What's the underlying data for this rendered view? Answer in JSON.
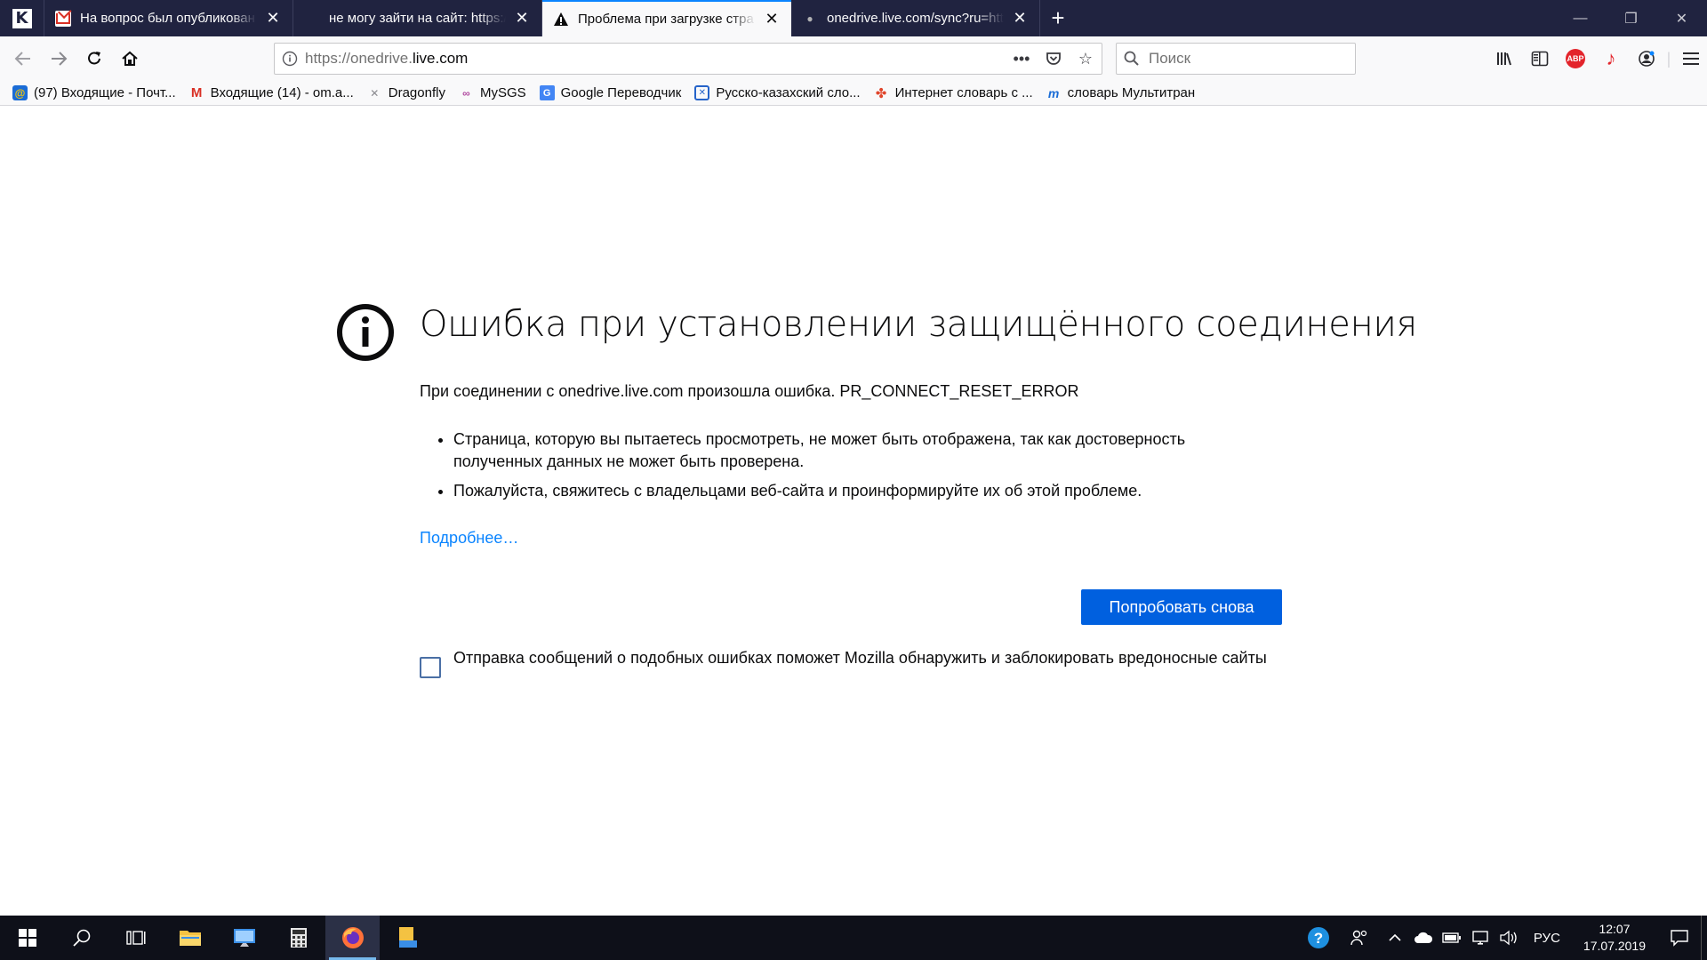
{
  "tabs": [
    {
      "title": "На вопрос был опубликован",
      "favicon": "gmail-icon",
      "active": false
    },
    {
      "title": "не могу зайти на сайт: https://",
      "favicon": "microsoft-icon",
      "active": false
    },
    {
      "title": "Проблема при загрузке стра",
      "favicon": "warning-icon",
      "active": true
    },
    {
      "title": "onedrive.live.com/sync?ru=http",
      "favicon": "loading-dot-icon",
      "active": false
    }
  ],
  "nav": {
    "url_prefix": "https://onedrive.",
    "url_host": "live.com",
    "search_placeholder": "Поиск"
  },
  "bookmarks": [
    {
      "label": "(97) Входящие - Почт...",
      "icon": "mail-at-icon"
    },
    {
      "label": "Входящие (14) - om.a...",
      "icon": "gmail-icon"
    },
    {
      "label": "Dragonfly",
      "icon": "dragonfly-icon"
    },
    {
      "label": "MySGS",
      "icon": "mysgs-icon"
    },
    {
      "label": "Google Переводчик",
      "icon": "google-translate-icon"
    },
    {
      "label": "Русско-казахский сло...",
      "icon": "dictionary-icon"
    },
    {
      "label": "Интернет словарь с ...",
      "icon": "pinwheel-icon"
    },
    {
      "label": "словарь Мультитран",
      "icon": "multitran-icon"
    }
  ],
  "error": {
    "title": "Ошибка при установлении защищённого соединения",
    "description": "При соединении с onedrive.live.com произошла ошибка. PR_CONNECT_RESET_ERROR",
    "bullets": [
      "Страница, которую вы пытаетесь просмотреть, не может быть отображена, так как достоверность полученных данных не может быть проверена.",
      "Пожалуйста, свяжитесь с владельцами веб-сайта и проинформируйте их об этой проблеме."
    ],
    "learn_more": "Подробнее…",
    "retry_label": "Попробовать снова",
    "report_label": "Отправка сообщений о подобных ошибках поможет Mozilla обнаружить и заблокировать вредоносные сайты"
  },
  "taskbar": {
    "language": "РУС",
    "time": "12:07",
    "date": "17.07.2019"
  },
  "colors": {
    "tabstrip": "#202340",
    "accent_blue": "#0060df",
    "link_blue": "#0a84ff",
    "taskbar": "#0e1019"
  }
}
